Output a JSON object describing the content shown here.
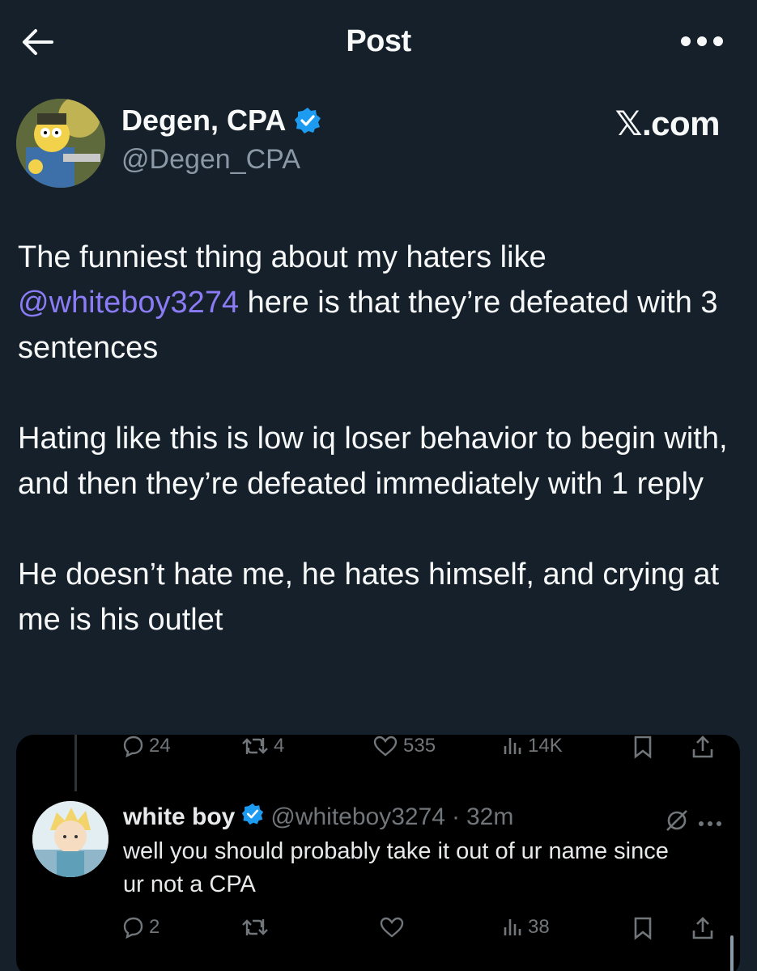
{
  "header": {
    "title": "Post"
  },
  "post": {
    "author_name": "Degen, CPA",
    "author_handle": "@Degen_CPA",
    "brand": "𝕏.com",
    "line1": "The funniest thing about my haters like",
    "mention": "@whiteboy3274",
    "line2_rest": " here is that they’re defeated with 3 sentences",
    "paragraph2": "Hating like this is low iq loser behavior to begin with, and then they’re defeated immediately with 1 reply",
    "paragraph3": "He doesn’t hate me, he hates himself, and crying at me is his outlet"
  },
  "parent_actions": {
    "replies": "24",
    "reposts": "4",
    "likes": "535",
    "views": "14K"
  },
  "reply": {
    "name": "white boy",
    "handle": "@whiteboy3274",
    "dot": "·",
    "time": "32m",
    "text": "well you should probably take it out of ur name since ur not a CPA",
    "actions": {
      "replies": "2",
      "views": "38"
    }
  },
  "colors": {
    "background": "#15202b",
    "card_background": "#000000",
    "mention": "#8b7cf6",
    "verified": "#1d9bf0",
    "muted_text": "#8b98a5"
  },
  "icons": [
    "back-arrow-icon",
    "more-horizontal-icon",
    "verified-badge-icon",
    "reply-icon",
    "repost-icon",
    "like-icon",
    "views-icon",
    "bookmark-icon",
    "share-icon",
    "muted-icon"
  ]
}
